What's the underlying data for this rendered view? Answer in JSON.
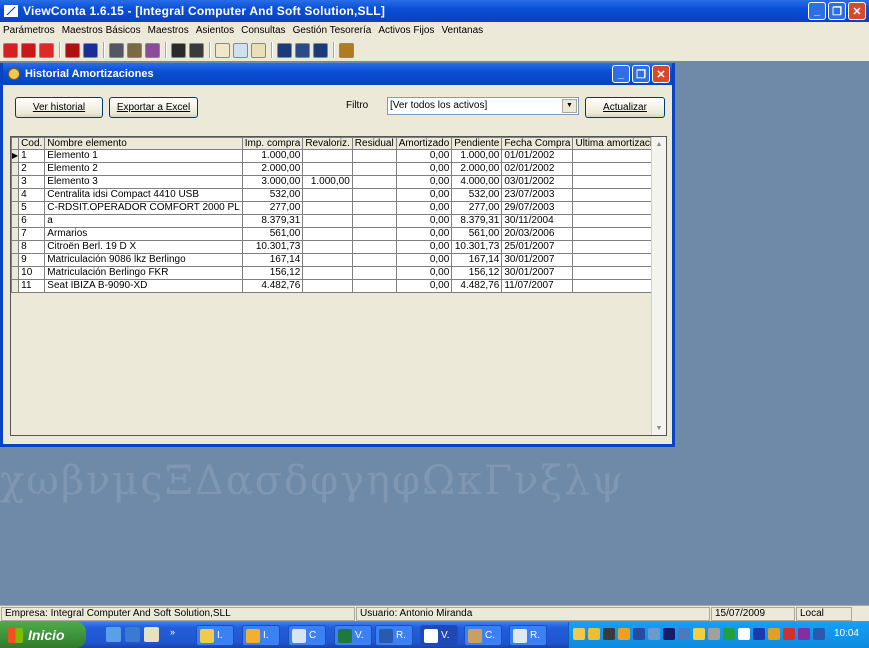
{
  "app": {
    "title": "ViewConta 1.6.15 - [Integral Computer And Soft Solution,SLL]"
  },
  "menu": [
    "Parámetros",
    "Maestros Básicos",
    "Maestros",
    "Asientos",
    "Consultas",
    "Gestión Tesorería",
    "Activos Fijos",
    "Ventanas"
  ],
  "toolbar": {
    "icons": [
      {
        "name": "pdf-red-icon",
        "color": "#d42020"
      },
      {
        "name": "report-red-icon",
        "color": "#c81818"
      },
      {
        "name": "acrobat-icon",
        "color": "#e02828"
      },
      {
        "name": "book-red-icon",
        "color": "#b01010"
      },
      {
        "name": "book-blue-icon",
        "color": "#1a2e9a"
      },
      {
        "name": "gear-icon",
        "color": "#555566"
      },
      {
        "name": "gears-icon",
        "color": "#7a6a44"
      },
      {
        "name": "gears-colored-icon",
        "color": "#8a4c9a"
      },
      {
        "name": "open-book-icon",
        "color": "#2a2a2a"
      },
      {
        "name": "book-pages-icon",
        "color": "#3a3a3a"
      },
      {
        "name": "folder-open-icon",
        "color": "#f0e8c8"
      },
      {
        "name": "folder-arrows-icon",
        "color": "#d0e0f0"
      },
      {
        "name": "folder-stack-icon",
        "color": "#e8e0b8"
      },
      {
        "name": "document-list-icon",
        "color": "#1a3a7a"
      },
      {
        "name": "document-ledger-icon",
        "color": "#2a4a8a"
      },
      {
        "name": "document-table-icon",
        "color": "#1a3a7a"
      },
      {
        "name": "exit-door-icon",
        "color": "#b07a20"
      }
    ]
  },
  "window": {
    "title": "Historial Amortizaciones",
    "buttons": {
      "ver_historial": "Ver historial",
      "exportar_excel": "Exportar a Excel",
      "actualizar": "Actualizar"
    },
    "filter": {
      "label": "Filtro",
      "value": "[Ver todos los activos]"
    }
  },
  "grid": {
    "columns": [
      "Cod.",
      "Nombre elemento",
      "Imp. compra",
      "Revaloriz.",
      "Residual",
      "Amortizado",
      "Pendiente",
      "Fecha Compra",
      "Ultima amortización"
    ],
    "rows": [
      [
        "1",
        "Elemento 1",
        "1.000,00",
        "",
        "",
        "0,00",
        "1.000,00",
        "01/01/2002",
        ""
      ],
      [
        "2",
        "Elemento 2",
        "2.000,00",
        "",
        "",
        "0,00",
        "2.000,00",
        "02/01/2002",
        ""
      ],
      [
        "3",
        "Elemento 3",
        "3.000,00",
        "1.000,00",
        "",
        "0,00",
        "4.000,00",
        "03/01/2002",
        ""
      ],
      [
        "4",
        "Centralita idsi Compact 4410 USB",
        "532,00",
        "",
        "",
        "0,00",
        "532,00",
        "23/07/2003",
        ""
      ],
      [
        "5",
        "C-RDSIT.OPERADOR COMFORT 2000 PL",
        "277,00",
        "",
        "",
        "0,00",
        "277,00",
        "29/07/2003",
        ""
      ],
      [
        "6",
        "a",
        "8.379,31",
        "",
        "",
        "0,00",
        "8.379,31",
        "30/11/2004",
        ""
      ],
      [
        "7",
        "Armarios",
        "561,00",
        "",
        "",
        "0,00",
        "561,00",
        "20/03/2006",
        ""
      ],
      [
        "8",
        "Citroën Berl. 19 D X",
        "10.301,73",
        "",
        "",
        "0,00",
        "10.301,73",
        "25/01/2007",
        ""
      ],
      [
        "9",
        "Matriculación 9086 lkz Berlingo",
        "167,14",
        "",
        "",
        "0,00",
        "167,14",
        "30/01/2007",
        ""
      ],
      [
        "10",
        "Matriculación Berlingo FKR",
        "156,12",
        "",
        "",
        "0,00",
        "156,12",
        "30/01/2007",
        ""
      ],
      [
        "11",
        " Seat IBIZA B-9090-XD",
        "4.482,76",
        "",
        "",
        "0,00",
        "4.482,76",
        "11/07/2007",
        ""
      ]
    ],
    "selected_row_indicator": "▶"
  },
  "watermark": "χωβνμςΞΔασδφγηφΩκΓνξλψ",
  "statusbar": {
    "empresa": "Empresa: Integral Computer And Soft Solution,SLL",
    "usuario": "Usuario: Antonio Miranda",
    "fecha": "15/07/2009",
    "ubicacion": "Local"
  },
  "taskbar": {
    "start_label": "Inicio",
    "tasks": [
      "I.",
      "I.",
      "C",
      "V.",
      "R.",
      "V.",
      "C.",
      "R."
    ],
    "clock": "10:04"
  }
}
